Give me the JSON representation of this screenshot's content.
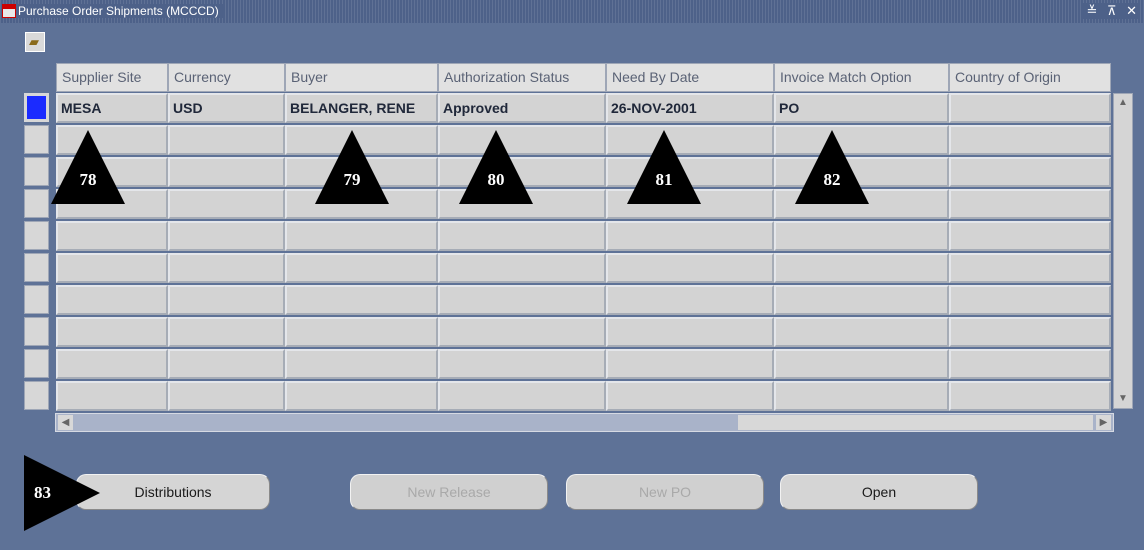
{
  "window": {
    "title": "Purchase Order Shipments (MCCCD)",
    "controls": "≚ ⊼ ✕"
  },
  "toolbar": {
    "folder_icon": "folder-icon"
  },
  "table": {
    "columns": [
      "Supplier Site",
      "Currency",
      "Buyer",
      "Authorization Status",
      "Need By Date",
      "Invoice Match Option",
      "Country of Origin"
    ],
    "rows": [
      [
        "MESA",
        "USD",
        "BELANGER, RENE",
        "Approved",
        "26-NOV-2001",
        "PO",
        ""
      ]
    ],
    "empty_rows": 9
  },
  "buttons": {
    "distributions": "Distributions",
    "new_release": "New Release",
    "new_po": "New PO",
    "open": "Open"
  },
  "callouts": {
    "supplier_site": "78",
    "buyer": "79",
    "authorization_status": "80",
    "need_by_date": "81",
    "invoice_match_option": "82",
    "distributions": "83"
  }
}
